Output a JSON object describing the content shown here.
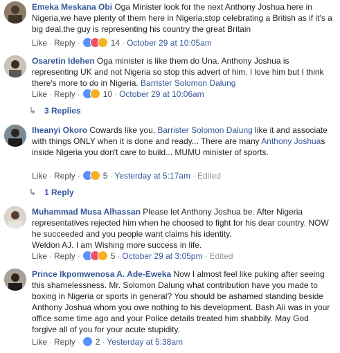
{
  "comments": [
    {
      "author": "Emeka Meskana Obi",
      "text": [
        {
          "t": "Oga Minister look for the next Anthony Joshua here in Nigeria,we have plenty of them here in Nigeria,stop celebrating a British as if it's a big deal,the guy is representing his country the great Britain"
        }
      ],
      "like": "Like",
      "reply": "Reply",
      "reactions": [
        "like",
        "love",
        "haha"
      ],
      "count": "14",
      "time": "October 29 at 10:05am",
      "edited": ""
    },
    {
      "author": "Osaretin Idehen",
      "text": [
        {
          "t": "Oga minister is like them do Una. Anthony Joshua is representing UK and not Nigeria so stop this advert of him. I love him but I think there's more to do in Nigeria. "
        },
        {
          "t": "Barrister Solomon Dalung",
          "m": true
        }
      ],
      "like": "Like",
      "reply": "Reply",
      "reactions": [
        "like",
        "haha"
      ],
      "count": "10",
      "time": "October 29 at 10:06am",
      "edited": "",
      "replies": "3 Replies"
    },
    {
      "author": "Iheanyi Okoro",
      "text": [
        {
          "t": "Cowards like you, "
        },
        {
          "t": "Barrister Solomon Dalung",
          "m": true
        },
        {
          "t": " like it and associate with things ONLY when it is done and ready... There are many "
        },
        {
          "t": "Anthony Joshua",
          "m": true
        },
        {
          "t": "s inside Nigeria you don't care to build... MUMU minister of sports."
        }
      ],
      "like": "Like",
      "reply": "Reply",
      "reactions": [
        "like",
        "haha"
      ],
      "count": "5",
      "time": "Yesterday at 5:17am",
      "edited": "Edited",
      "replies": "1 Reply"
    },
    {
      "author": "Muhammad Musa Alhassan",
      "text": [
        {
          "t": "Please let Anthony Joshua be. After Nigeria representatives rejected him when he choosed to fight for his dear country. NOW he succeeded and you people want claims his identity.\nWeldon AJ. I am Wishing more success in life."
        }
      ],
      "like": "Like",
      "reply": "Reply",
      "reactions": [
        "like",
        "love",
        "haha"
      ],
      "count": "5",
      "time": "October 29 at 3:05pm",
      "edited": "Edited"
    },
    {
      "author": "Prince Ikpomwenosa A. Ade-Eweka",
      "text": [
        {
          "t": "Now I almost feel like puking after seeing this shamelessness. Mr. Solomon Dalung what contribution have you made to boxing in Nigeria or sports in general? You should be ashamed standing beside Anthony Joshua whom you owe nothing to his development. Bash Ali was in your office some time ago and your Police details treated him shabbily. May God forgive all of you for your acute stupidity."
        }
      ],
      "like": "Like",
      "reply": "Reply",
      "reactions": [
        "like"
      ],
      "count": "2",
      "time": "Yesterday at 5:38am",
      "edited": ""
    }
  ],
  "colors": {
    "link": "#365899",
    "meta": "#90949c",
    "like": "#5890ff",
    "love": "#f25268",
    "haha": "#f7b125"
  }
}
